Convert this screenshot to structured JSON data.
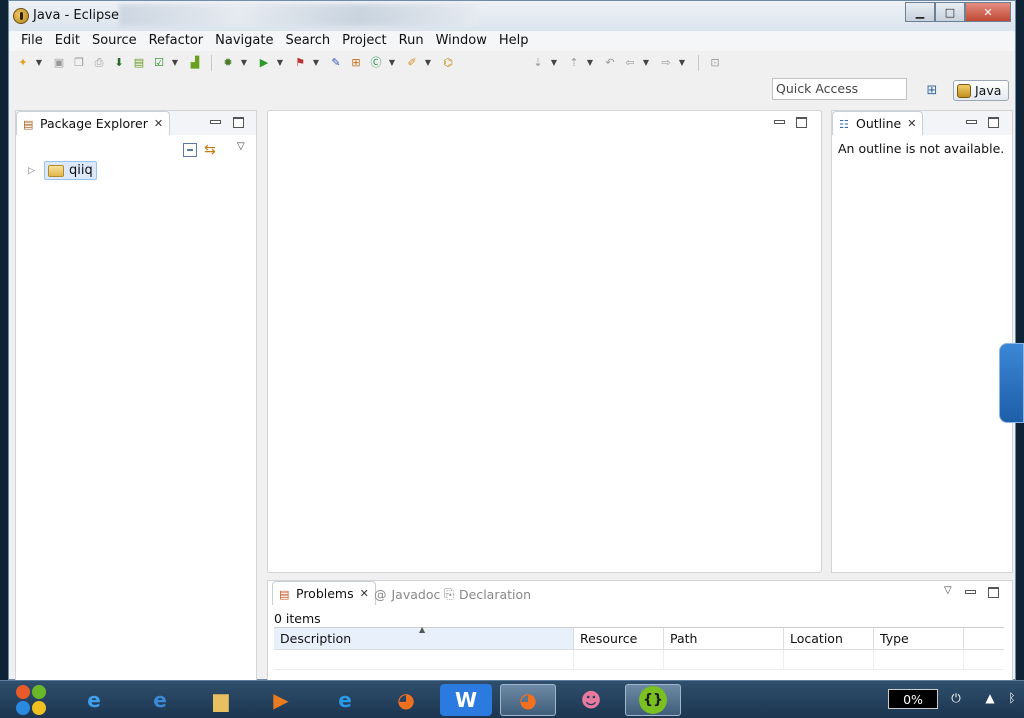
{
  "window": {
    "title": "Java - Eclipse",
    "controls": {
      "minimize": "▁",
      "maximize": "□",
      "close": "✕"
    }
  },
  "menu": [
    "File",
    "Edit",
    "Source",
    "Refactor",
    "Navigate",
    "Search",
    "Project",
    "Run",
    "Window",
    "Help"
  ],
  "quick_access": {
    "placeholder": "Quick Access"
  },
  "perspective": {
    "label": "Java"
  },
  "package_explorer": {
    "tab_label": "Package Explorer",
    "tree": [
      {
        "label": "qiiq",
        "expanded": false
      }
    ]
  },
  "outline": {
    "tab_label": "Outline",
    "message": "An outline is not available."
  },
  "problems": {
    "tabs": [
      "Problems",
      "Javadoc",
      "Declaration"
    ],
    "count": "0 items",
    "columns": [
      "Description",
      "Resource",
      "Path",
      "Location",
      "Type"
    ]
  },
  "taskbar": {
    "battery": "0%",
    "icons": [
      "start-orb",
      "ie",
      "ie-2",
      "explorer",
      "media",
      "ie-3",
      "browser",
      "wps",
      "browser-active",
      "qq",
      "code-editor"
    ]
  },
  "colors": {
    "accent": "#3b87d6",
    "selection": "#dbe9fb",
    "taskbar": "#1c3550"
  }
}
